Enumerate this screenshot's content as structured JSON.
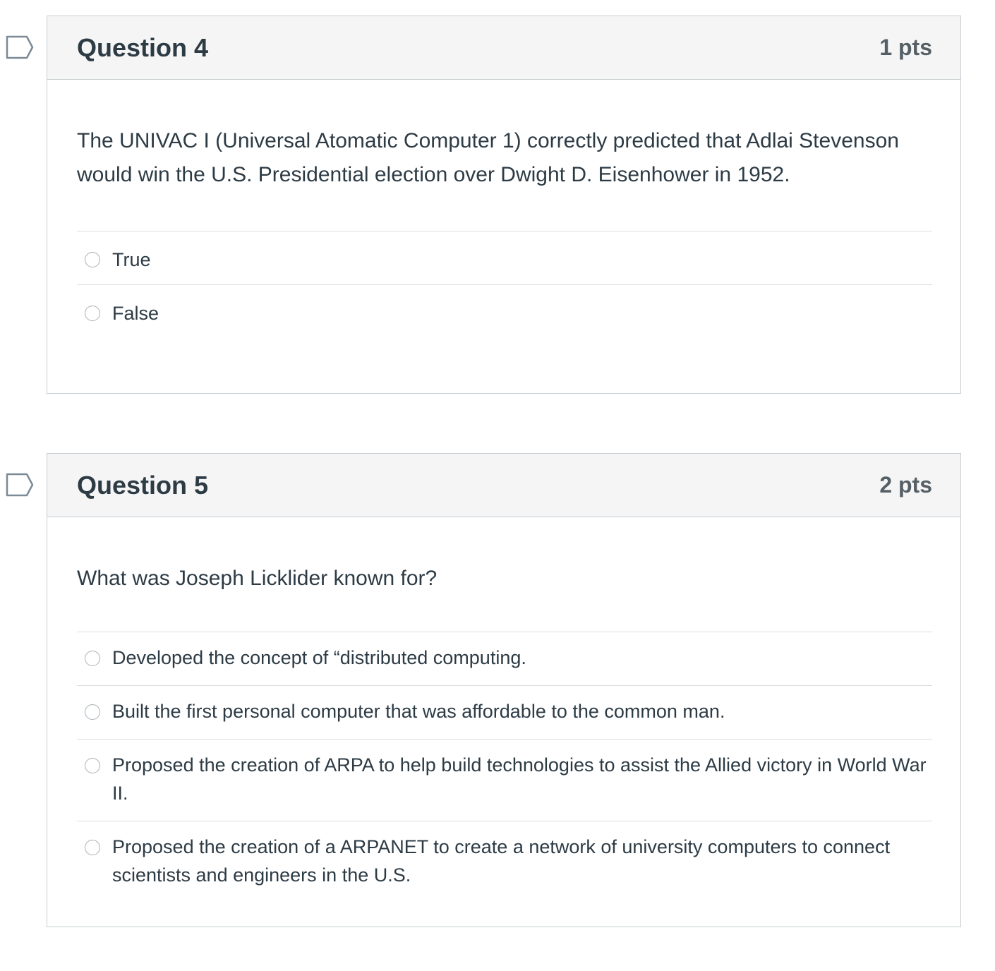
{
  "questions": [
    {
      "title": "Question 4",
      "points": "1 pts",
      "text": "The UNIVAC I (Universal Atomatic Computer 1) correctly predicted that Adlai Stevenson would win the U.S. Presidential election over Dwight D. Eisenhower in 1952.",
      "answers": [
        {
          "label": "True"
        },
        {
          "label": "False"
        }
      ]
    },
    {
      "title": "Question 5",
      "points": "2 pts",
      "text": "What was Joseph Licklider known for?",
      "answers": [
        {
          "label": "Developed the concept of “distributed computing."
        },
        {
          "label": "Built the first personal computer that was affordable to the common man."
        },
        {
          "label": "Proposed the creation of ARPA to help build technologies to assist the Allied victory in World War II."
        },
        {
          "label": "Proposed the creation of a ARPANET to create a network of university computers to connect scientists and engineers in the U.S."
        }
      ]
    }
  ],
  "colors": {
    "header_bg": "#f5f5f5",
    "border": "#c7cdd1",
    "text": "#2d3b45",
    "flag": "#7a8a96"
  }
}
